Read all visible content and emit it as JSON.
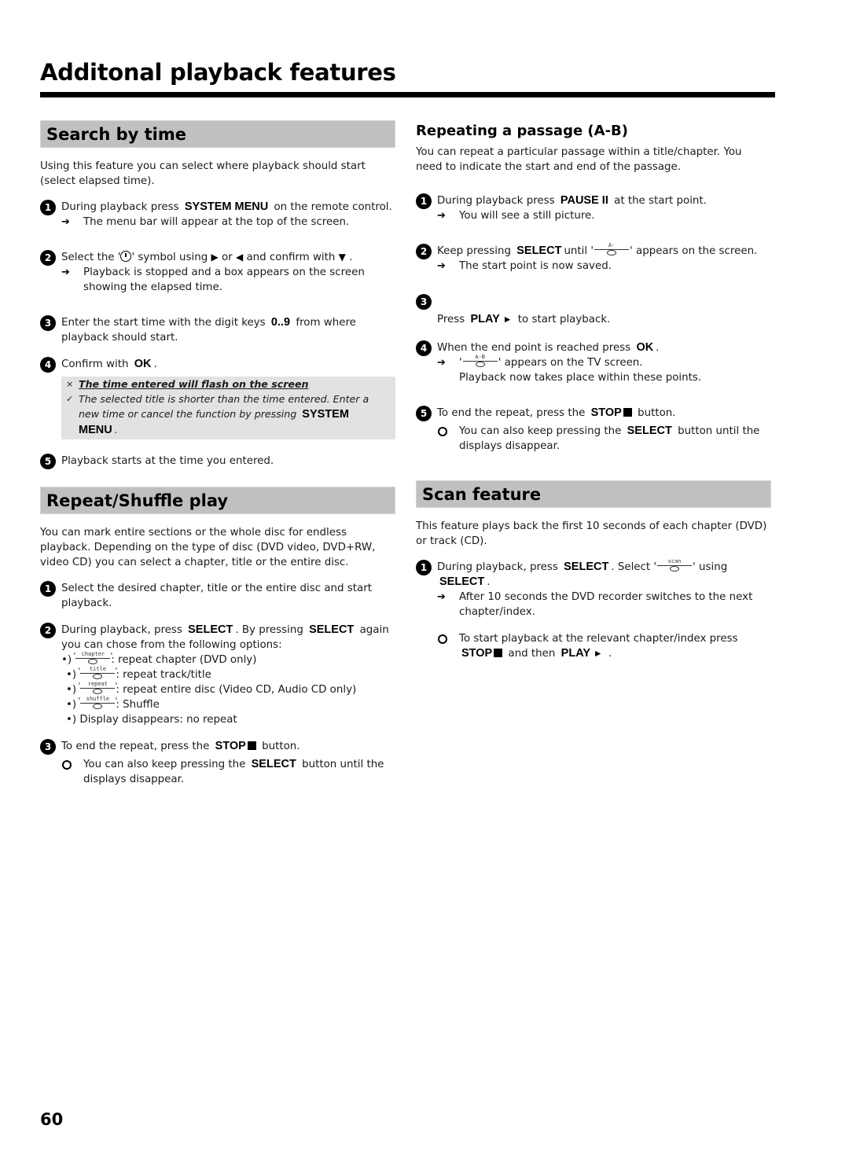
{
  "page": {
    "title": "Additonal playback features",
    "page_number": "60"
  },
  "search_by_time": {
    "heading": "Search by time",
    "intro": "Using this feature you can select where playback should start (select elapsed time).",
    "steps": [
      {
        "num": "1",
        "pre": "During playback press",
        "key": "SYSTEM MENU",
        "post": "on the remote control.",
        "result": "The menu bar will appear at the top of the screen."
      },
      {
        "num": "2",
        "pre": "Select the '",
        "icon": "clock-icon",
        "mid1": "' symbol using",
        "mid2": "or",
        "mid3": "and confirm with",
        "post": ".",
        "result": "Playback is stopped and a box appears on the screen showing the elapsed time."
      },
      {
        "num": "3",
        "pre": "Enter the start time with the digit keys",
        "key": "0..9",
        "post": "from where playback should start."
      },
      {
        "num": "4",
        "pre": "Confirm with",
        "key": "OK",
        "post": "."
      },
      {
        "num": "5",
        "text": "Playback starts at the time you entered."
      }
    ],
    "note": {
      "problem": "The time entered will flash on the screen",
      "solution_pre": "The selected title is shorter than the time entered. Enter a new time or cancel the function by pressing",
      "solution_key": "SYSTEM MENU",
      "solution_post": "."
    }
  },
  "repeat_shuffle": {
    "heading": "Repeat/Shuffle play",
    "intro": "You can mark entire sections or the whole disc for endless playback. Depending on the type of disc (DVD video, DVD+RW, video CD) you can select a chapter, title or the entire disc.",
    "steps": [
      {
        "num": "1",
        "text": "Select the desired chapter, title or the entire disc and start playback."
      },
      {
        "num": "2",
        "pre": "During playback, press",
        "key": "SELECT",
        "mid": ". By pressing",
        "key2": "SELECT",
        "post": "again you can chose from the following options:"
      },
      {
        "num": "3",
        "pre": "To end the repeat, press the",
        "key": "STOP",
        "post": "button.",
        "tip_pre": "You can also keep pressing the",
        "tip_key": "SELECT",
        "tip_post": "button until the displays disappear."
      }
    ],
    "options": [
      {
        "bullet": "•)",
        "osd": "chapter",
        "desc": ": repeat chapter (DVD only)"
      },
      {
        "bullet": "•)",
        "osd": "title",
        "desc": ": repeat track/title"
      },
      {
        "bullet": "•)",
        "osd": "repeat",
        "desc": ": repeat entire disc (Video CD, Audio CD only)"
      },
      {
        "bullet": "•)",
        "osd": "shuffle",
        "desc": ": Shuffle"
      },
      {
        "bullet": "•)",
        "desc": "Display disappears: no repeat"
      }
    ]
  },
  "repeat_ab": {
    "heading": "Repeating a passage (A-B)",
    "intro": "You can repeat a particular passage within a title/chapter. You need to indicate the start and end of the passage.",
    "steps": [
      {
        "num": "1",
        "pre": "During playback press",
        "key": "PAUSE II",
        "post": "at the start point.",
        "result": "You will see a still picture."
      },
      {
        "num": "2",
        "pre": "Keep pressing",
        "key": "SELECT",
        "mid": "until '",
        "osd": "A-",
        "post": "' appears on the screen.",
        "result": "The start point is now saved."
      },
      {
        "num": "3",
        "pre": "Press",
        "key": "PLAY",
        "post": "to start playback."
      },
      {
        "num": "4",
        "pre": "When the end point is reached press",
        "key": "OK",
        "post": ".",
        "result_osd": "A-B",
        "result_post": "' appears on the TV screen.",
        "result_line2": "Playback now takes place within these points."
      },
      {
        "num": "5",
        "pre": "To end the repeat, press the",
        "key": "STOP",
        "post": "button.",
        "tip_pre": "You can also keep pressing the",
        "tip_key": "SELECT",
        "tip_post": "button until the displays disappear."
      }
    ]
  },
  "scan": {
    "heading": "Scan feature",
    "intro": "This feature plays back the first 10 seconds of each chapter (DVD) or track (CD).",
    "step1": {
      "num": "1",
      "pre": "During playback, press",
      "key": "SELECT",
      "mid": ". Select '",
      "osd": "scan",
      "post": "' using",
      "key2": "SELECT",
      "post2": ".",
      "result": "After 10 seconds the DVD recorder switches to the next chapter/index."
    },
    "tip": {
      "pre": "To start playback at the relevant chapter/index press",
      "key": "STOP",
      "mid": "and then",
      "key2": "PLAY",
      "post": "."
    }
  },
  "glyphs": {
    "arrow": "➔",
    "right_triangle": "▶",
    "left_triangle": "◀",
    "down_triangle": "▼",
    "play_triangle": "►",
    "cross": "×",
    "check": "✓"
  }
}
